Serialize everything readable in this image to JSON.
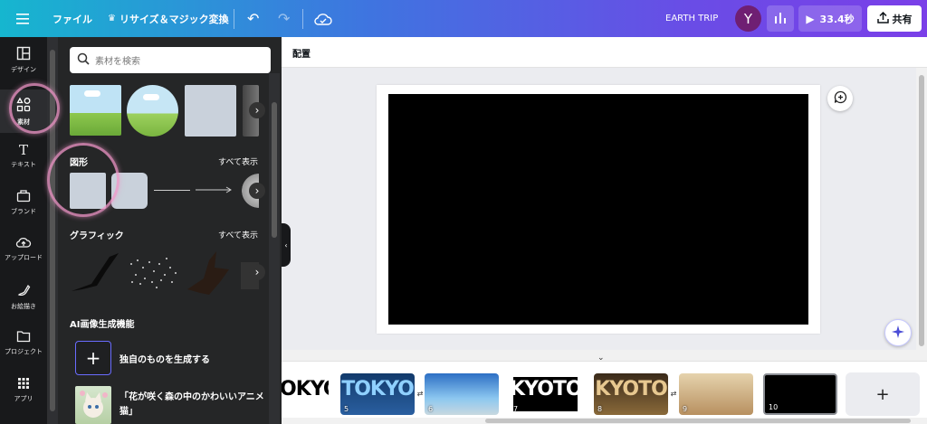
{
  "topbar": {
    "menu_icon": "hamburger-icon",
    "file_label": "ファイル",
    "resize_label": "リサイズ＆マジック変換",
    "design_title": "EARTH TRIP",
    "avatar_letter": "Y",
    "play_time": "33.4秒",
    "share_label": "共有"
  },
  "rail": [
    {
      "label": "デザイン",
      "icon": "layout-icon"
    },
    {
      "label": "素材",
      "icon": "elements-icon"
    },
    {
      "label": "テキスト",
      "icon": "text-icon"
    },
    {
      "label": "ブランド",
      "icon": "brand-icon"
    },
    {
      "label": "アップロード",
      "icon": "upload-icon"
    },
    {
      "label": "お絵描き",
      "icon": "draw-icon"
    },
    {
      "label": "プロジェクト",
      "icon": "folder-icon"
    },
    {
      "label": "アプリ",
      "icon": "apps-icon"
    }
  ],
  "panel": {
    "search_placeholder": "素材を検索",
    "shapes_title": "図形",
    "shapes_see_all": "すべて表示",
    "graphics_title": "グラフィック",
    "graphics_see_all": "すべて表示",
    "ai_title": "AI画像生成機能",
    "generate_label": "独自のものを生成する",
    "suggestion_label": "「花が咲く森の中のかわいいアニメ猫」"
  },
  "canvas": {
    "toolbar_label": "配置"
  },
  "filmstrip": [
    {
      "num": "",
      "word": "OKYO",
      "style": "dark"
    },
    {
      "num": "5",
      "word": "TOKYO",
      "style": "blue"
    },
    {
      "num": "6",
      "word": "",
      "style": "city"
    },
    {
      "num": "7",
      "word": "KYOTO",
      "style": "dark"
    },
    {
      "num": "8",
      "word": "KYOTO",
      "style": "gold"
    },
    {
      "num": "9",
      "word": "",
      "style": "temple"
    },
    {
      "num": "10",
      "word": "",
      "style": "black"
    }
  ],
  "add_page_label": "+"
}
